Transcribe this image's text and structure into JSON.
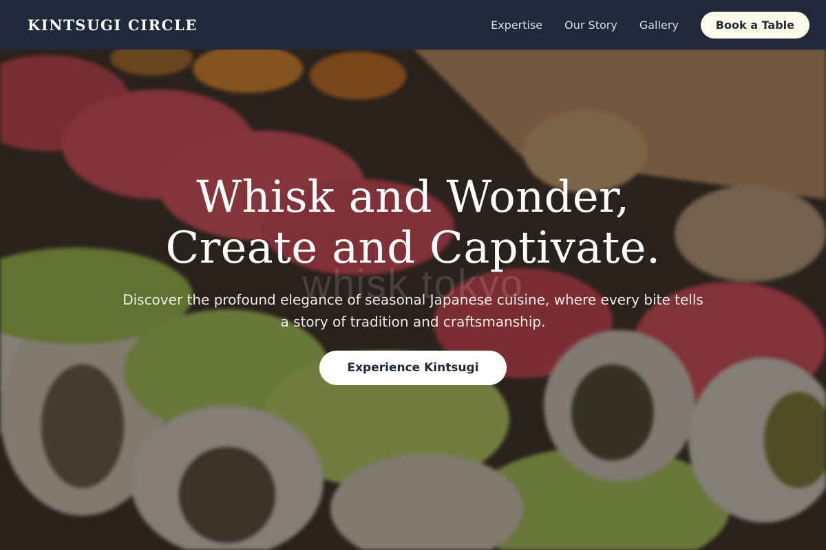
{
  "header": {
    "brand": "KINTSUGI CIRCLE",
    "nav": [
      {
        "label": "Expertise"
      },
      {
        "label": "Our Story"
      },
      {
        "label": "Gallery"
      }
    ],
    "cta_label": "Book a Table"
  },
  "hero": {
    "title_line1": "Whisk and Wonder,",
    "title_line2": "Create and Captivate.",
    "subtitle": "Discover the profound elegance of seasonal Japanese cuisine, where every bite tells a story of tradition and craftsmanship.",
    "cta_label": "Experience Kintsugi",
    "watermark": "whisk tokyo"
  },
  "colors": {
    "nav_background": "#1f293a",
    "button_background": "#fdfbea",
    "overlay": "rgba(20,16,14,0.42)"
  }
}
